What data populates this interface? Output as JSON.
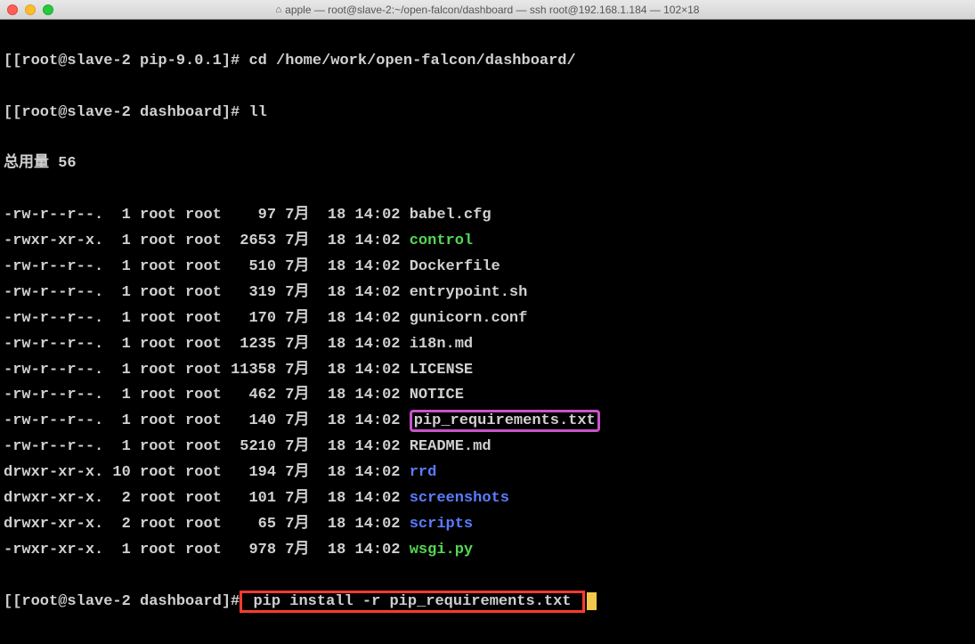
{
  "window": {
    "title": "apple — root@slave-2:~/open-falcon/dashboard — ssh root@192.168.1.184 — 102×18"
  },
  "prompt1": {
    "br1": "[",
    "user": "[root@slave-2 pip-9.0.1]#",
    "cmd": " cd /home/work/open-falcon/dashboard/"
  },
  "prompt2": {
    "br1": "[",
    "user": "[root@slave-2 dashboard]#",
    "cmd": " ll"
  },
  "total": "总用量 56",
  "files": [
    {
      "perm": "-rw-r--r--.",
      "links": "  1",
      "own": "root",
      "grp": "root",
      "size": "   97",
      "mon": "7月",
      "day": "  18",
      "time": "14:02",
      "name": "babel.cfg",
      "type": "plain"
    },
    {
      "perm": "-rwxr-xr-x.",
      "links": "  1",
      "own": "root",
      "grp": "root",
      "size": " 2653",
      "mon": "7月",
      "day": "  18",
      "time": "14:02",
      "name": "control",
      "type": "exec"
    },
    {
      "perm": "-rw-r--r--.",
      "links": "  1",
      "own": "root",
      "grp": "root",
      "size": "  510",
      "mon": "7月",
      "day": "  18",
      "time": "14:02",
      "name": "Dockerfile",
      "type": "plain"
    },
    {
      "perm": "-rw-r--r--.",
      "links": "  1",
      "own": "root",
      "grp": "root",
      "size": "  319",
      "mon": "7月",
      "day": "  18",
      "time": "14:02",
      "name": "entrypoint.sh",
      "type": "plain"
    },
    {
      "perm": "-rw-r--r--.",
      "links": "  1",
      "own": "root",
      "grp": "root",
      "size": "  170",
      "mon": "7月",
      "day": "  18",
      "time": "14:02",
      "name": "gunicorn.conf",
      "type": "plain"
    },
    {
      "perm": "-rw-r--r--.",
      "links": "  1",
      "own": "root",
      "grp": "root",
      "size": " 1235",
      "mon": "7月",
      "day": "  18",
      "time": "14:02",
      "name": "i18n.md",
      "type": "plain"
    },
    {
      "perm": "-rw-r--r--.",
      "links": "  1",
      "own": "root",
      "grp": "root",
      "size": "11358",
      "mon": "7月",
      "day": "  18",
      "time": "14:02",
      "name": "LICENSE",
      "type": "plain"
    },
    {
      "perm": "-rw-r--r--.",
      "links": "  1",
      "own": "root",
      "grp": "root",
      "size": "  462",
      "mon": "7月",
      "day": "  18",
      "time": "14:02",
      "name": "NOTICE",
      "type": "plain"
    },
    {
      "perm": "-rw-r--r--.",
      "links": "  1",
      "own": "root",
      "grp": "root",
      "size": "  140",
      "mon": "7月",
      "day": "  18",
      "time": "14:02",
      "name": "pip_requirements.txt",
      "type": "plain",
      "hl": "magenta"
    },
    {
      "perm": "-rw-r--r--.",
      "links": "  1",
      "own": "root",
      "grp": "root",
      "size": " 5210",
      "mon": "7月",
      "day": "  18",
      "time": "14:02",
      "name": "README.md",
      "type": "plain"
    },
    {
      "perm": "drwxr-xr-x.",
      "links": " 10",
      "own": "root",
      "grp": "root",
      "size": "  194",
      "mon": "7月",
      "day": "  18",
      "time": "14:02",
      "name": "rrd",
      "type": "dir"
    },
    {
      "perm": "drwxr-xr-x.",
      "links": "  2",
      "own": "root",
      "grp": "root",
      "size": "  101",
      "mon": "7月",
      "day": "  18",
      "time": "14:02",
      "name": "screenshots",
      "type": "dir"
    },
    {
      "perm": "drwxr-xr-x.",
      "links": "  2",
      "own": "root",
      "grp": "root",
      "size": "   65",
      "mon": "7月",
      "day": "  18",
      "time": "14:02",
      "name": "scripts",
      "type": "dir"
    },
    {
      "perm": "-rwxr-xr-x.",
      "links": "  1",
      "own": "root",
      "grp": "root",
      "size": "  978",
      "mon": "7月",
      "day": "  18",
      "time": "14:02",
      "name": "wsgi.py",
      "type": "exec"
    }
  ],
  "prompt3": {
    "br1": "[",
    "user": "[root@slave-2 dashboard]#",
    "cmd": " pip install -r pip_requirements.txt "
  }
}
